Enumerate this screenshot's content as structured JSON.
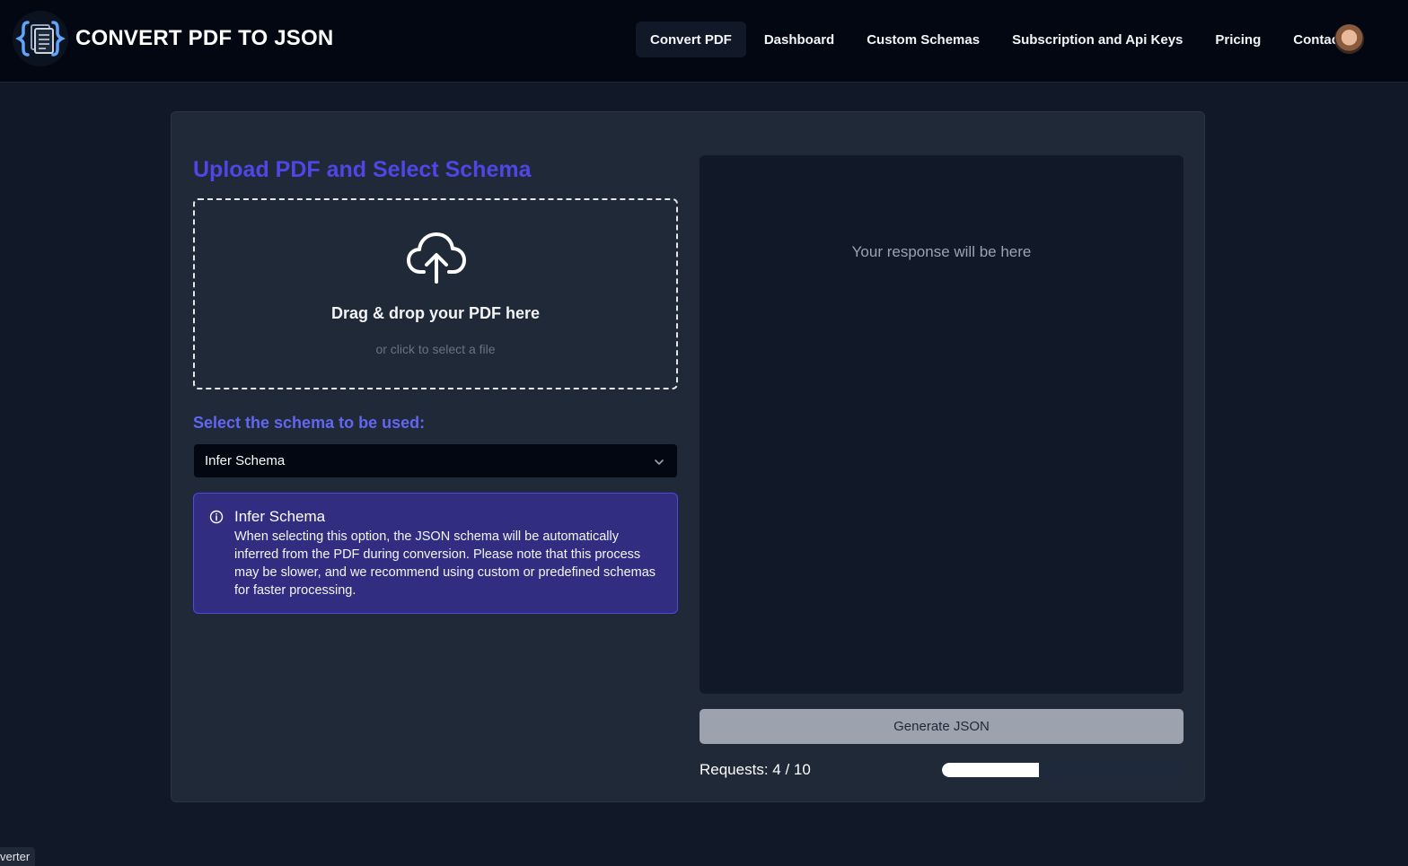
{
  "brand": {
    "title": "CONVERT PDF TO JSON",
    "logo_icon": "document-braces-icon"
  },
  "nav": {
    "items": [
      {
        "label": "Convert PDF",
        "active": true
      },
      {
        "label": "Dashboard",
        "active": false
      },
      {
        "label": "Custom Schemas",
        "active": false
      },
      {
        "label": "Subscription and Api Keys",
        "active": false
      },
      {
        "label": "Pricing",
        "active": false
      },
      {
        "label": "Contact",
        "active": false
      }
    ],
    "avatar_icon": "user-avatar"
  },
  "upload": {
    "title": "Upload PDF and Select Schema",
    "drop_icon": "cloud-upload-icon",
    "drop_title": "Drag & drop your PDF here",
    "drop_subtitle": "or click to select a file"
  },
  "schema": {
    "label": "Select the schema to be used:",
    "selected": "Infer Schema"
  },
  "alert": {
    "icon": "info-icon",
    "title": "Infer Schema",
    "body": "When selecting this option, the JSON schema will be automatically inferred from the PDF during conversion. Please note that this process may be slower, and we recommend using custom or predefined schemas for faster processing."
  },
  "response": {
    "placeholder": "Your response will be here"
  },
  "actions": {
    "generate_label": "Generate JSON"
  },
  "usage": {
    "label": "Requests: 4 / 10",
    "used": 4,
    "limit": 10
  },
  "footer": {
    "tag": "verter"
  },
  "colors": {
    "accent": "#4f46e5",
    "accent_light": "#6366f1",
    "alert_bg": "#312e81",
    "page_bg": "#111827",
    "header_bg": "#030712"
  }
}
